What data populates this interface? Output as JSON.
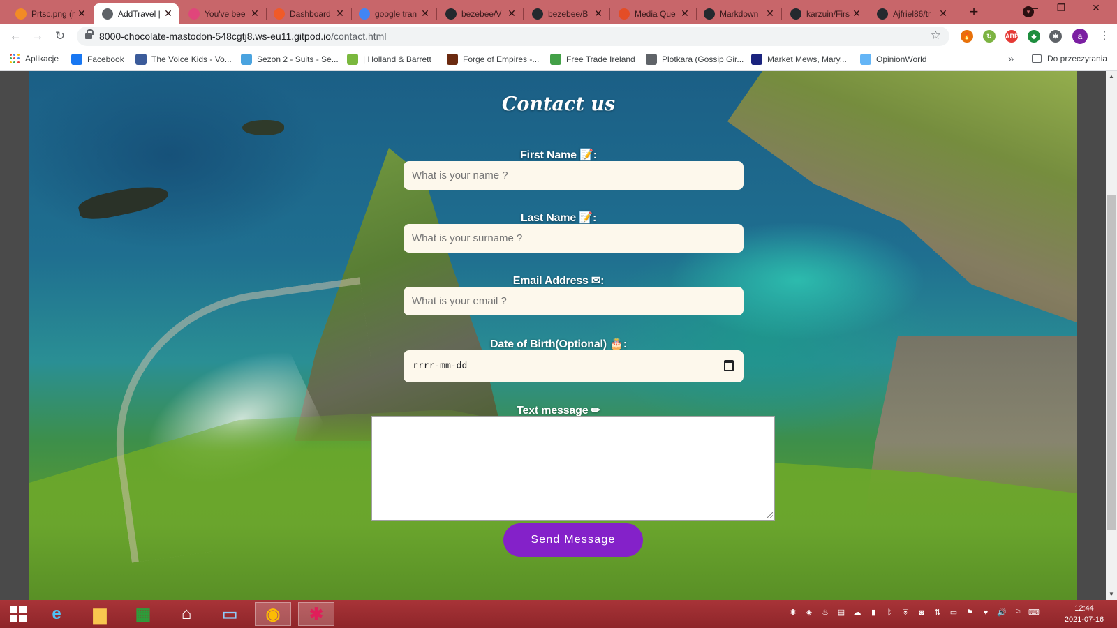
{
  "browser": {
    "tabs": [
      {
        "title": "Prtsc.png (r",
        "color": "#f28b25"
      },
      {
        "title": "AddTravel |",
        "color": "#5f6368",
        "active": true
      },
      {
        "title": "You've bee",
        "color": "#e0457b"
      },
      {
        "title": "Dashboard",
        "color": "#f05a28"
      },
      {
        "title": "google tran",
        "color": "#4285f4"
      },
      {
        "title": "bezebee/V",
        "color": "#24292e"
      },
      {
        "title": "bezebee/B",
        "color": "#24292e"
      },
      {
        "title": "Media Que",
        "color": "#e44d26"
      },
      {
        "title": "Markdown",
        "color": "#24292e"
      },
      {
        "title": "karzuin/Firs",
        "color": "#24292e"
      },
      {
        "title": "Ajfriel86/tr",
        "color": "#24292e"
      }
    ],
    "tab_close_glyph": "✕",
    "new_tab_glyph": "+",
    "url_host": "8000-chocolate-mastodon-548cgtj8.ws-eu11.gitpod.io",
    "url_path": "/contact.html",
    "profile_initial": "a",
    "extensions": [
      {
        "name": "fire-extension-icon",
        "color": "#e8710a",
        "label": "🔥"
      },
      {
        "name": "loop-extension-icon",
        "color": "#7cb342",
        "label": "↻"
      },
      {
        "name": "adblock-extension-icon",
        "color": "#e53935",
        "label": "ABP"
      },
      {
        "name": "shield-extension-icon",
        "color": "#1e8e3e",
        "label": "◆"
      },
      {
        "name": "puzzle-extension-icon",
        "color": "#5f6368",
        "label": "✱"
      }
    ]
  },
  "bookmarks": {
    "apps_label": "Aplikacje",
    "items": [
      {
        "label": "Facebook",
        "color": "#1877f2"
      },
      {
        "label": "The Voice Kids - Vo...",
        "color": "#3b5b9a"
      },
      {
        "label": "Sezon 2 - Suits - Se...",
        "color": "#4aa3df"
      },
      {
        "label": "| Holland & Barrett",
        "color": "#7ab83e"
      },
      {
        "label": "Forge of Empires -...",
        "color": "#6b2a10"
      },
      {
        "label": "Free Trade Ireland",
        "color": "#43a047"
      },
      {
        "label": "Plotkara (Gossip Gir...",
        "color": "#5f6368"
      },
      {
        "label": "Market Mews, Mary...",
        "color": "#1a237e"
      },
      {
        "label": "OpinionWorld",
        "color": "#64b5f6"
      }
    ],
    "more_glyph": "»",
    "reading_list_label": "Do przeczytania"
  },
  "contact": {
    "title": "Contact us",
    "first_name_label": "First Name 📝:",
    "first_name_placeholder": "What is your name ?",
    "last_name_label": "Last Name 📝:",
    "last_name_placeholder": "What is your surname ?",
    "email_label": "Email Address ✉:",
    "email_placeholder": "What is your email ?",
    "dob_label": "Date of Birth(Optional) 🎂:",
    "dob_value": "rrrr-mm-dd",
    "message_label": "Text message ✏",
    "message_value": "",
    "send_label": "Send Message",
    "button_color": "#8421c9"
  },
  "taskbar": {
    "apps": [
      {
        "name": "internet-explorer-icon",
        "glyph": "e",
        "color": "#4fc3f7",
        "open": false
      },
      {
        "name": "file-explorer-icon",
        "glyph": "▆",
        "color": "#f9c74f",
        "open": false
      },
      {
        "name": "store-icon",
        "glyph": "▦",
        "color": "#2e9c3a",
        "open": false
      },
      {
        "name": "home-icon",
        "glyph": "⌂",
        "color": "#ffffff",
        "open": false
      },
      {
        "name": "monitor-icon",
        "glyph": "▭",
        "color": "#90caf9",
        "open": false
      },
      {
        "name": "chrome-icon",
        "glyph": "◉",
        "color": "#fbbc04",
        "open": true
      },
      {
        "name": "slack-icon",
        "glyph": "✱",
        "color": "#e01e5a",
        "open": true
      }
    ],
    "clock_time": "12:44",
    "clock_date": "2021-07-16"
  }
}
